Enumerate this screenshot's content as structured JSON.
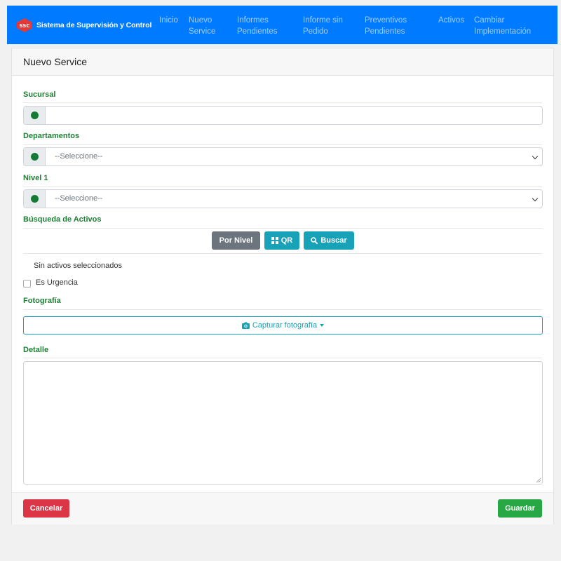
{
  "brand": {
    "logo_text": "SSC",
    "title": "Sistema de Supervisión y Control"
  },
  "nav": {
    "inicio": "Inicio",
    "nuevo_service": [
      "Nuevo",
      "Service"
    ],
    "informes_pendientes": [
      "Informes",
      "Pendientes"
    ],
    "informe_sin_pedido": [
      "Informe sin",
      "Pedido"
    ],
    "preventivos_pendientes": [
      "Preventivos",
      "Pendientes"
    ],
    "activos": "Activos",
    "cambiar_implementacion": [
      "Cambiar",
      "Implementación"
    ]
  },
  "form": {
    "title": "Nuevo Service",
    "sucursal": {
      "label": "Sucursal",
      "value": ""
    },
    "departamentos": {
      "label": "Departamentos",
      "selected": "--Seleccione--"
    },
    "nivel1": {
      "label": "Nivel 1",
      "selected": "--Seleccione--"
    },
    "busqueda": {
      "label": "Búsqueda de Activos",
      "por_nivel": "Por Nivel",
      "qr": "QR",
      "buscar": "Buscar"
    },
    "sin_activos": "Sin activos seleccionados",
    "es_urgencia": {
      "label": "Es Urgencia",
      "checked": false
    },
    "fotografia": {
      "label": "Fotografía",
      "capture": "Capturar fotografía"
    },
    "detalle": {
      "label": "Detalle",
      "value": ""
    },
    "cancelar": "Cancelar",
    "guardar": "Guardar"
  },
  "colors": {
    "navbar": "#007bff",
    "label_green": "#1e7e34",
    "info": "#17a2b8",
    "danger": "#dc3545",
    "success": "#28a745",
    "secondary": "#6c757d"
  }
}
